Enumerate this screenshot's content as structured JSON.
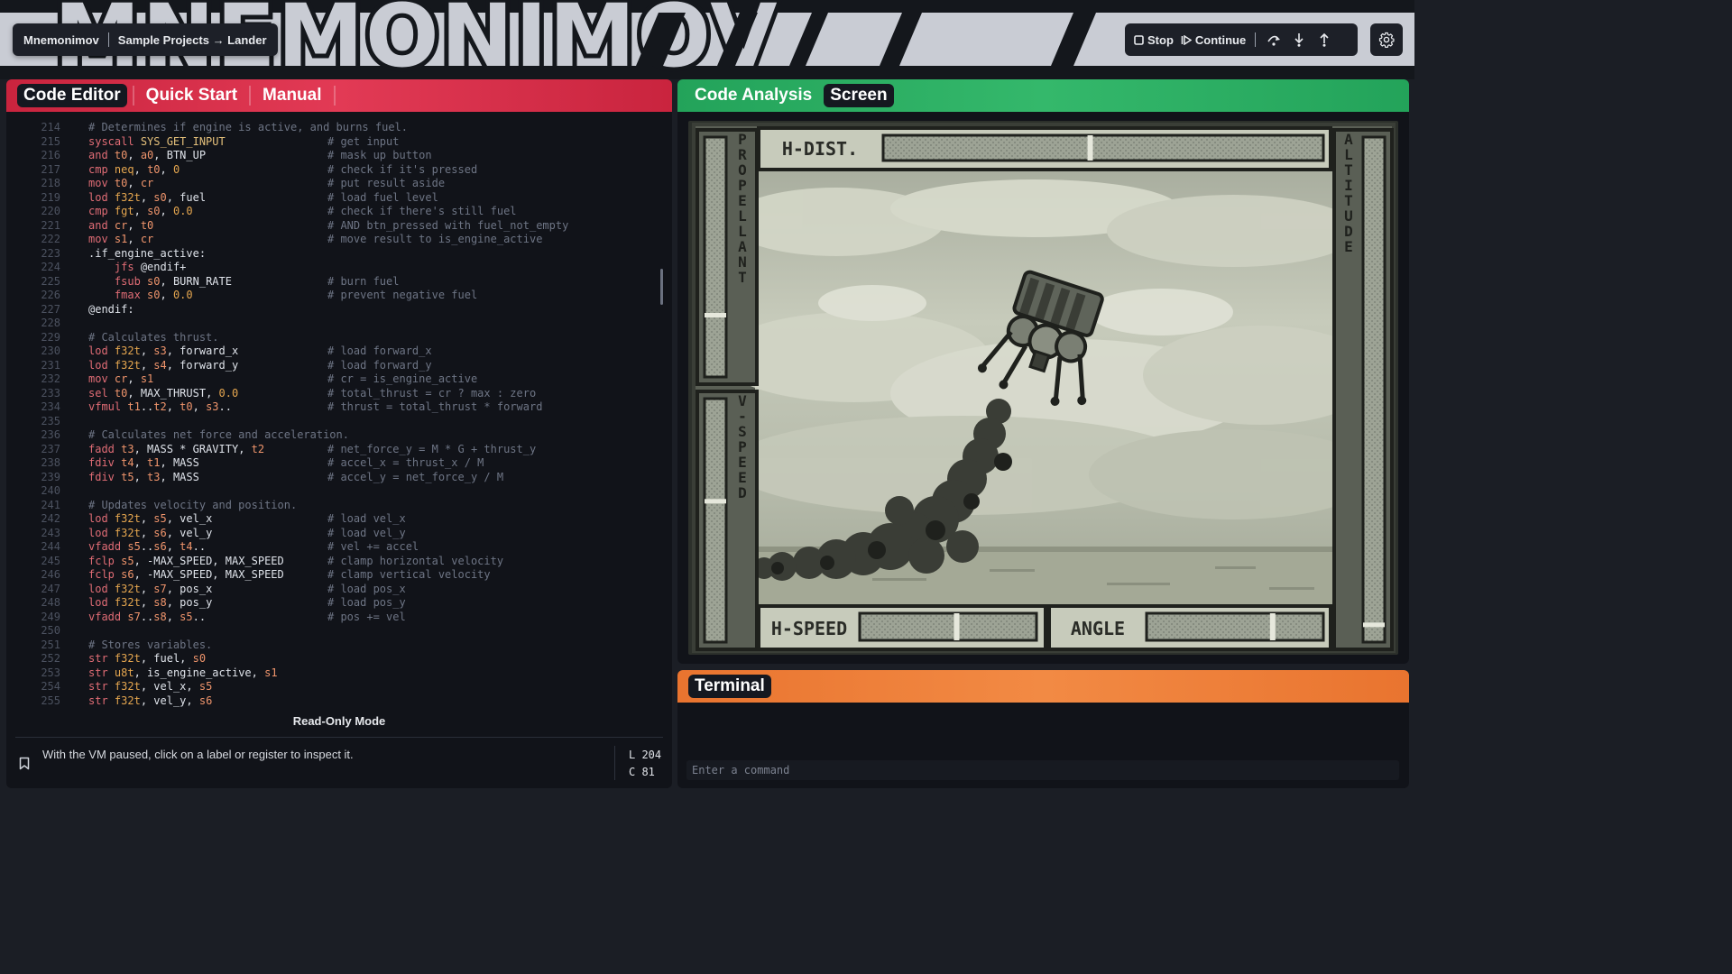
{
  "app": {
    "title": "MNEMONIMOV",
    "breadcrumb": [
      "Mnemonimov",
      "Sample Projects → Lander"
    ]
  },
  "controls": {
    "stop_label": "Stop",
    "continue_label": "Continue",
    "icons": [
      "step-over-icon",
      "step-into-icon",
      "step-out-icon",
      "gear-icon"
    ]
  },
  "editor": {
    "tabs": [
      "Code Editor",
      "Quick Start",
      "Manual"
    ],
    "active_tab": "Code Editor",
    "lines": [
      {
        "n": "214",
        "code": "# Determines if engine is active, and burns fuel.",
        "comment": ""
      },
      {
        "n": "215",
        "code": "syscall SYS_GET_INPUT",
        "comment": "# get input"
      },
      {
        "n": "216",
        "code": "and t0, a0, BTN_UP",
        "comment": "# mask up button"
      },
      {
        "n": "217",
        "code": "cmp neq, t0, 0",
        "comment": "# check if it's pressed"
      },
      {
        "n": "218",
        "code": "mov t0, cr",
        "comment": "# put result aside"
      },
      {
        "n": "219",
        "code": "lod f32t, s0, fuel",
        "comment": "# load fuel level"
      },
      {
        "n": "220",
        "code": "cmp fgt, s0, 0.0",
        "comment": "# check if there's still fuel"
      },
      {
        "n": "221",
        "code": "and cr, t0",
        "comment": "# AND btn_pressed with fuel_not_empty"
      },
      {
        "n": "222",
        "code": "mov s1, cr",
        "comment": "# move result to is_engine_active"
      },
      {
        "n": "223",
        "code": ".if_engine_active:",
        "comment": ""
      },
      {
        "n": "224",
        "code": "    jfs @endif+",
        "comment": ""
      },
      {
        "n": "225",
        "code": "    fsub s0, BURN_RATE",
        "comment": "# burn fuel"
      },
      {
        "n": "226",
        "code": "    fmax s0, 0.0",
        "comment": "# prevent negative fuel"
      },
      {
        "n": "227",
        "code": "@endif:",
        "comment": ""
      },
      {
        "n": "228",
        "code": "",
        "comment": ""
      },
      {
        "n": "229",
        "code": "# Calculates thrust.",
        "comment": ""
      },
      {
        "n": "230",
        "code": "lod f32t, s3, forward_x",
        "comment": "# load forward_x"
      },
      {
        "n": "231",
        "code": "lod f32t, s4, forward_y",
        "comment": "# load forward_y"
      },
      {
        "n": "232",
        "code": "mov cr, s1",
        "comment": "# cr = is_engine_active"
      },
      {
        "n": "233",
        "code": "sel t0, MAX_THRUST, 0.0",
        "comment": "# total_thrust = cr ? max : zero"
      },
      {
        "n": "234",
        "code": "vfmul t1..t2, t0, s3..",
        "comment": "# thrust = total_thrust * forward"
      },
      {
        "n": "235",
        "code": "",
        "comment": ""
      },
      {
        "n": "236",
        "code": "# Calculates net force and acceleration.",
        "comment": ""
      },
      {
        "n": "237",
        "code": "fadd t3, MASS * GRAVITY, t2",
        "comment": "# net_force_y = M * G + thrust_y"
      },
      {
        "n": "238",
        "code": "fdiv t4, t1, MASS",
        "comment": "# accel_x = thrust_x / M"
      },
      {
        "n": "239",
        "code": "fdiv t5, t3, MASS",
        "comment": "# accel_y = net_force_y / M"
      },
      {
        "n": "240",
        "code": "",
        "comment": ""
      },
      {
        "n": "241",
        "code": "# Updates velocity and position.",
        "comment": ""
      },
      {
        "n": "242",
        "code": "lod f32t, s5, vel_x",
        "comment": "# load vel_x"
      },
      {
        "n": "243",
        "code": "lod f32t, s6, vel_y",
        "comment": "# load vel_y"
      },
      {
        "n": "244",
        "code": "vfadd s5..s6, t4..",
        "comment": "# vel += accel"
      },
      {
        "n": "245",
        "code": "fclp s5, -MAX_SPEED, MAX_SPEED",
        "comment": "# clamp horizontal velocity"
      },
      {
        "n": "246",
        "code": "fclp s6, -MAX_SPEED, MAX_SPEED",
        "comment": "# clamp vertical velocity"
      },
      {
        "n": "247",
        "code": "lod f32t, s7, pos_x",
        "comment": "# load pos_x"
      },
      {
        "n": "248",
        "code": "lod f32t, s8, pos_y",
        "comment": "# load pos_y"
      },
      {
        "n": "249",
        "code": "vfadd s7..s8, s5..",
        "comment": "# pos += vel"
      },
      {
        "n": "250",
        "code": "",
        "comment": ""
      },
      {
        "n": "251",
        "code": "# Stores variables.",
        "comment": ""
      },
      {
        "n": "252",
        "code": "str f32t, fuel, s0",
        "comment": ""
      },
      {
        "n": "253",
        "code": "str u8t, is_engine_active, s1",
        "comment": ""
      },
      {
        "n": "254",
        "code": "str f32t, vel_x, s5",
        "comment": ""
      },
      {
        "n": "255",
        "code": "str f32t, vel_y, s6",
        "comment": ""
      }
    ],
    "mode_label": "Read-Only Mode",
    "hint": "With the VM paused, click on a label or register to inspect it.",
    "line_indicator": "L 204",
    "col_indicator": "C 81"
  },
  "analysis": {
    "tabs": [
      "Code Analysis",
      "Screen"
    ],
    "active_tab": "Screen",
    "game": {
      "gauges": {
        "propellant_label": "PROPELLANT",
        "vspeed_label": "V-SPEED",
        "altitude_label": "ALTITUDE",
        "hdist_label": "H-DIST.",
        "hspeed_label": "H-SPEED",
        "angle_label": "ANGLE",
        "propellant_level": 0.25,
        "vspeed_level": 0.58,
        "altitude_level": 0.03,
        "hdist_level": 0.47,
        "hspeed_level": 0.55,
        "angle_level": 0.72
      }
    }
  },
  "terminal": {
    "tab": "Terminal",
    "placeholder": "Enter a command"
  },
  "colors": {
    "editor_accent": "#e23a55",
    "analysis_accent": "#34b86b",
    "terminal_accent": "#f28a44",
    "keyword": "#e06c75",
    "register": "#f0956c",
    "number": "#e5a64f",
    "comment": "#6e7585"
  }
}
